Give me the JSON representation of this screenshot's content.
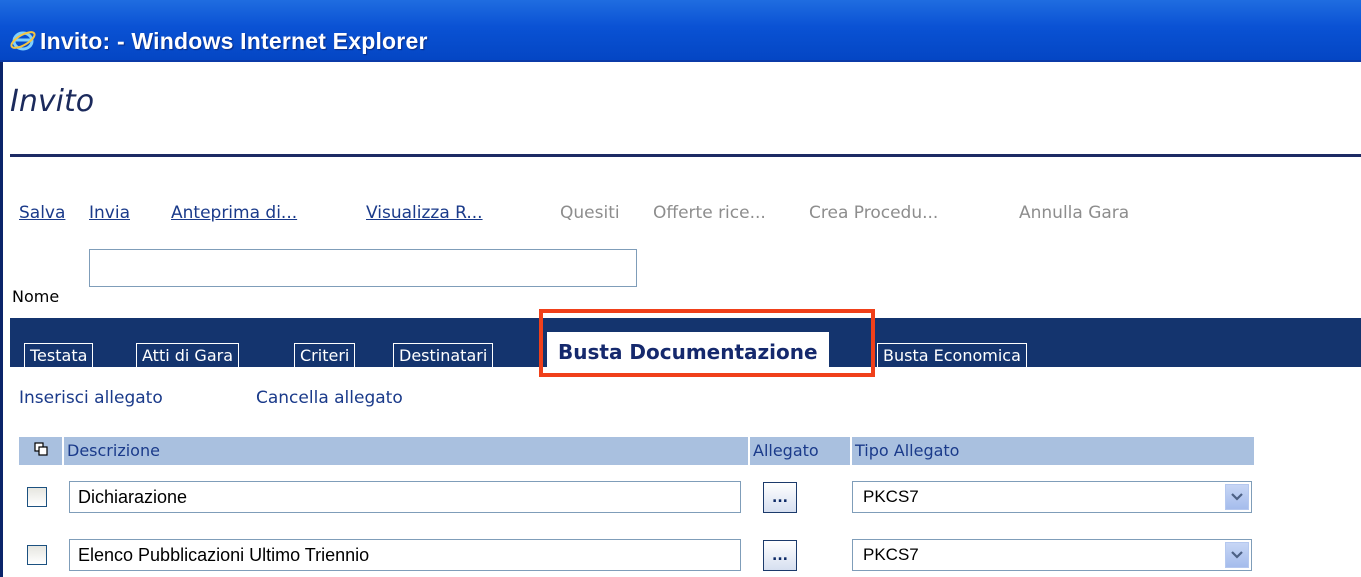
{
  "window": {
    "title": "Invito: - Windows Internet Explorer"
  },
  "page": {
    "title": "Invito"
  },
  "toolbar": {
    "items": [
      {
        "label": "Salva",
        "enabled": true
      },
      {
        "label": "Invia",
        "enabled": true
      },
      {
        "label": "Anteprima di...",
        "enabled": true
      },
      {
        "label": "Visualizza R...",
        "enabled": true
      },
      {
        "label": "Quesiti",
        "enabled": false
      },
      {
        "label": "Offerte rice...",
        "enabled": false
      },
      {
        "label": "Crea Procedu...",
        "enabled": false
      },
      {
        "label": "Annulla Gara",
        "enabled": false
      }
    ]
  },
  "form": {
    "nome_label": "Nome",
    "nome_value": ""
  },
  "tabs": [
    {
      "label": "Testata",
      "active": false
    },
    {
      "label": "Atti di Gara",
      "active": false
    },
    {
      "label": "Criteri",
      "active": false
    },
    {
      "label": "Destinatari",
      "active": false
    },
    {
      "label": "Busta Documentazione",
      "active": true
    },
    {
      "label": "Busta Economica",
      "active": false
    }
  ],
  "actions": {
    "insert_label": "Inserisci allegato",
    "delete_label": "Cancella allegato"
  },
  "grid": {
    "columns": {
      "select_icon": "copy-icon",
      "descrizione": "Descrizione",
      "allegato": "Allegato",
      "tipo_allegato": "Tipo Allegato"
    },
    "rows": [
      {
        "checked": false,
        "descrizione": "Dichiarazione",
        "browse_label": "...",
        "tipo": "PKCS7"
      },
      {
        "checked": false,
        "descrizione": "Elenco Pubblicazioni Ultimo Triennio",
        "browse_label": "...",
        "tipo": "PKCS7"
      }
    ]
  },
  "colors": {
    "titlebar": "#0a52d4",
    "tabstrip": "#14346e",
    "grid_header": "#a9c0df",
    "highlight": "#f0401a",
    "link": "#1a3a8a"
  }
}
